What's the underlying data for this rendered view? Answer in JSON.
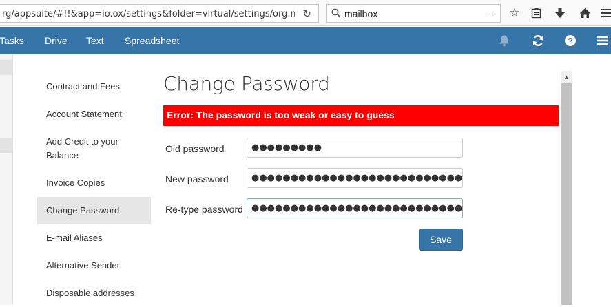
{
  "browser": {
    "url": "rg/appsuite/#!!&app=io.ox/settings&folder=virtual/settings/org.ma",
    "search_value": "mailbox"
  },
  "appbar": {
    "nav": [
      "Tasks",
      "Drive",
      "Text",
      "Spreadsheet"
    ]
  },
  "sidebar": {
    "items": [
      {
        "label": "Contract and Fees"
      },
      {
        "label": "Account Statement"
      },
      {
        "label": "Add Credit to your Balance"
      },
      {
        "label": "Invoice Copies"
      },
      {
        "label": "Change Password"
      },
      {
        "label": "E-mail Aliases"
      },
      {
        "label": "Alternative Sender"
      },
      {
        "label": "Disposable addresses"
      }
    ]
  },
  "main": {
    "title": "Change Password",
    "error": "Error: The password is too weak or easy to guess",
    "fields": [
      {
        "label": "Old password",
        "value": "●●●●●●●●●"
      },
      {
        "label": "New password",
        "value": "●●●●●●●●●●●●●●●●●●●●●●●●●●●●●●"
      },
      {
        "label": "Re-type password",
        "value": "●●●●●●●●●●●●●●●●●●●●●●●●●●●●●●"
      }
    ],
    "save_label": "Save"
  }
}
